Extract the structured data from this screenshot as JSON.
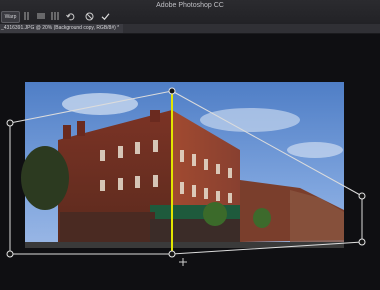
{
  "app": {
    "title": "Adobe Photoshop CC"
  },
  "options_bar": {
    "warp_label": "Warp"
  },
  "document_tab": {
    "label": "_4316391.JPG @ 20% (Background copy, RGB/8#) *"
  },
  "icons": {
    "grid": "grid-icon",
    "horizontal": "horizontal-lines-icon",
    "vertical": "vertical-lines-icon",
    "undo": "undo-icon",
    "cancel": "cancel-icon",
    "commit": "checkmark-icon"
  }
}
